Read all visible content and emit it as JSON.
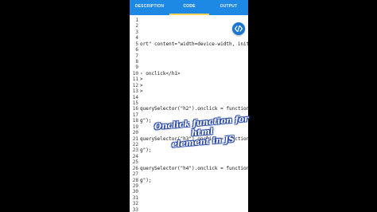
{
  "tabs": {
    "description": "DESCRIPTION",
    "code": "CODE",
    "output": "OUTPUT"
  },
  "editor": {
    "lines": [
      {
        "num": "1",
        "text": ""
      },
      {
        "num": "2",
        "text": ""
      },
      {
        "num": "3",
        "text": ""
      },
      {
        "num": "4",
        "text": ""
      },
      {
        "num": "5",
        "text": "ort\" content=\"width=device-width, initial-scale=1\""
      },
      {
        "num": "6",
        "text": ""
      },
      {
        "num": "7",
        "text": ""
      },
      {
        "num": "8",
        "text": ""
      },
      {
        "num": "9",
        "text": ""
      },
      {
        "num": "10",
        "text": "› onclick</h1>"
      },
      {
        "num": "11",
        "text": ">"
      },
      {
        "num": "12",
        "text": ">"
      },
      {
        "num": "13",
        "text": ">"
      },
      {
        "num": "14",
        "text": ""
      },
      {
        "num": "15",
        "text": ""
      },
      {
        "num": "16",
        "text": "querySelector(\"h2\").onclick = function()"
      },
      {
        "num": "17",
        "text": ""
      },
      {
        "num": "18",
        "text": "g\");"
      },
      {
        "num": "19",
        "text": ""
      },
      {
        "num": "20",
        "text": ""
      },
      {
        "num": "21",
        "text": "querySelector(\"h3\").onclick = function()"
      },
      {
        "num": "22",
        "text": ""
      },
      {
        "num": "23",
        "text": "g\");"
      },
      {
        "num": "24",
        "text": ""
      },
      {
        "num": "25",
        "text": ""
      },
      {
        "num": "26",
        "text": "querySelector(\"h4\").onclick = function()"
      },
      {
        "num": "27",
        "text": ""
      },
      {
        "num": "28",
        "text": "g\");"
      },
      {
        "num": "29",
        "text": ""
      },
      {
        "num": "30",
        "text": ""
      },
      {
        "num": "31",
        "text": ""
      },
      {
        "num": "32",
        "text": ""
      },
      {
        "num": "33",
        "text": ""
      }
    ]
  },
  "run_button": {
    "icon": "code-icon"
  },
  "overlay_caption": {
    "line1": "Onclick function for html",
    "line2": "element in JS"
  },
  "colors": {
    "tab_bar": "#1e88e5",
    "tab_indicator": "#ffd54f",
    "fab": "#1976d2",
    "caption_outline": "#2b4aa8"
  }
}
